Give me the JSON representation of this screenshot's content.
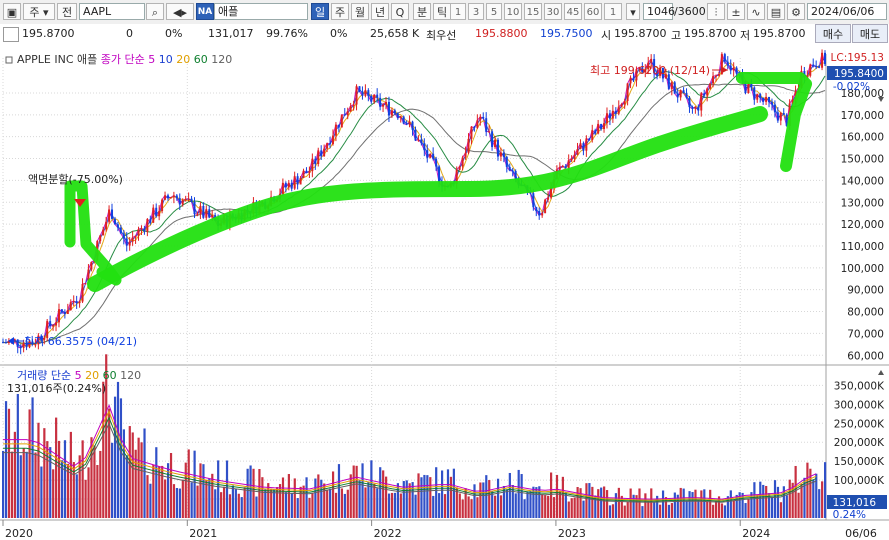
{
  "toolbar": {
    "period_type": "주",
    "prev_label": "전",
    "symbol": "AAPL",
    "exchange_badge": "NA",
    "name": "애플",
    "periods": [
      "일",
      "주",
      "월",
      "년",
      "Q",
      "분",
      "틱"
    ],
    "active_period": "일",
    "intervals": [
      "1",
      "3",
      "5",
      "10",
      "15",
      "30",
      "45",
      "60",
      "1"
    ],
    "bar_count": "1046",
    "bar_total": "/3600",
    "date": "2024/06/06"
  },
  "infobar": {
    "price": "195.8700",
    "change": "0",
    "change_pct": "0%",
    "volume": "131,017",
    "vol_ratio": "99.76%",
    "pct2": "0%",
    "amount": "25,658 K",
    "best_label": "최우선",
    "ask": "195.8800",
    "bid": "195.7500",
    "open_label": "시",
    "open": "195.8700",
    "high_label": "고",
    "high": "195.8700",
    "low_label": "저",
    "low": "195.8700",
    "buy_label": "매수",
    "sell_label": "매도"
  },
  "price_legend": {
    "name": "APPLE INC  애플",
    "ma_label": "종가 단순",
    "ma_periods": [
      "5",
      "10",
      "20",
      "60",
      "120"
    ],
    "ma_colors": [
      "#c000c0",
      "#1a3fd0",
      "#e0a000",
      "#108030",
      "#606060"
    ]
  },
  "volume_legend": {
    "title": "거래량 단순",
    "ma_periods": [
      "5",
      "20",
      "60",
      "120"
    ],
    "ma_colors": [
      "#c000c0",
      "#e0a000",
      "#108030",
      "#606060"
    ],
    "current": "131,016주(0.24%)"
  },
  "annotations": {
    "split": "액면분할(-75.00%)",
    "high": "최고 199.6200 (12/14)",
    "low": "최저 66.3575 (04/21)"
  },
  "price_axis": {
    "lc_label": "LC:195.13",
    "last_box": "195.8400",
    "last_pct": "-0.02%",
    "ticks": [
      "180,000",
      "170,000",
      "160,000",
      "150,000",
      "140,000",
      "130,000",
      "120,000",
      "110,000",
      "100,000",
      "90,000",
      "80,000",
      "70,000",
      "60,000"
    ]
  },
  "volume_axis": {
    "ticks": [
      "350,000K",
      "300,000K",
      "250,000K",
      "200,000K",
      "150,000K",
      "100,000K",
      "50,000K"
    ],
    "last_box": "131,016",
    "last_pct": "0.24%"
  },
  "time_axis": {
    "labels": [
      "2020",
      "2021",
      "2022",
      "2023",
      "2024"
    ],
    "end_label": "06/06"
  },
  "colors": {
    "up": "#e02020",
    "down": "#1040e0",
    "highlighter": "#22e010",
    "selected": "#2e62b8"
  },
  "chart_data": [
    {
      "type": "line",
      "title": "APPLE INC 애플",
      "series_label": "종가 (approx.)",
      "x": [
        "2020-03",
        "2020-06",
        "2020-08",
        "2020-09",
        "2020-12",
        "2021-03",
        "2021-06",
        "2021-09",
        "2021-12",
        "2022-03",
        "2022-06",
        "2022-08",
        "2022-10",
        "2022-12",
        "2023-01",
        "2023-04",
        "2023-07",
        "2023-10",
        "2023-12",
        "2024-01",
        "2024-04",
        "2024-05",
        "2024-06"
      ],
      "values": [
        66,
        88,
        127,
        110,
        134,
        120,
        130,
        145,
        180,
        170,
        135,
        170,
        143,
        125,
        143,
        165,
        195,
        171,
        197,
        185,
        167,
        189,
        195
      ],
      "ylim": [
        56,
        196
      ],
      "annotations": [
        {
          "x": "2020-08",
          "label": "액면분할(-75.00%)"
        },
        {
          "x": "2023-12",
          "label": "최고 199.6200 (12/14)"
        },
        {
          "x": "2020-04",
          "label": "최저 66.3575 (04/21)"
        }
      ]
    },
    {
      "type": "bar",
      "title": "거래량",
      "series_label": "거래량 (K, approx.)",
      "x": [
        "2020-03",
        "2020-06",
        "2020-08",
        "2020-09",
        "2020-12",
        "2021-03",
        "2021-06",
        "2021-09",
        "2021-12",
        "2022-03",
        "2022-06",
        "2022-08",
        "2022-10",
        "2022-12",
        "2023-01",
        "2023-04",
        "2023-07",
        "2023-10",
        "2023-12",
        "2024-01",
        "2024-04",
        "2024-05",
        "2024-06"
      ],
      "values": [
        230,
        140,
        340,
        180,
        140,
        110,
        90,
        85,
        120,
        90,
        100,
        75,
        95,
        80,
        85,
        60,
        55,
        60,
        55,
        65,
        75,
        110,
        131
      ],
      "ylim": [
        0,
        380
      ]
    }
  ]
}
